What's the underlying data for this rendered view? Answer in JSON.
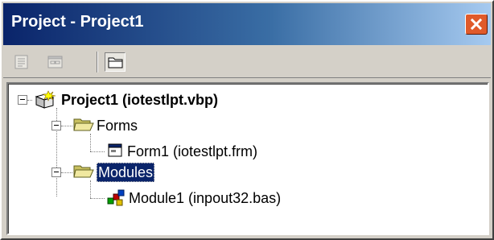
{
  "window": {
    "title": "Project - Project1",
    "colors": {
      "titlebar_start": "#0a246a",
      "titlebar_end": "#a6caf0",
      "close_button": "#e05a2a",
      "selection": "#0a246a"
    }
  },
  "toolbar": {
    "buttons": [
      {
        "name": "view-code",
        "icon": "view-code-icon",
        "enabled": false
      },
      {
        "name": "view-object",
        "icon": "view-object-icon",
        "enabled": false
      },
      {
        "name": "toggle-folders",
        "icon": "folder-icon",
        "pressed": true
      }
    ]
  },
  "tree": {
    "project": {
      "label": "Project1 (iotestlpt.vbp)",
      "icon": "vb-project-icon",
      "expanded": true
    },
    "forms_folder": {
      "label": "Forms",
      "icon": "folder-icon",
      "expanded": true
    },
    "form1": {
      "label": "Form1 (iotestlpt.frm)",
      "icon": "form-icon"
    },
    "modules_folder": {
      "label": "Modules",
      "icon": "folder-icon",
      "expanded": true,
      "selected": true
    },
    "module1": {
      "label": "Module1 (inpout32.bas)",
      "icon": "module-icon"
    }
  }
}
